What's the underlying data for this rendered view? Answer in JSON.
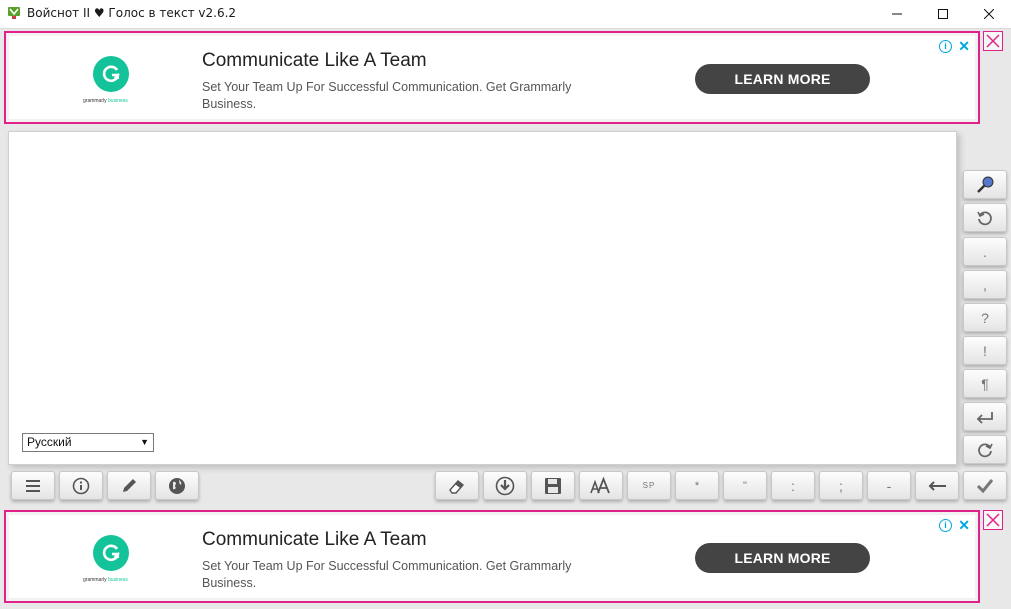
{
  "window": {
    "title": "Войснот II ♥ Голос в текст v2.6.2",
    "minimize_icon": "minimize-icon",
    "maximize_icon": "maximize-icon",
    "close_icon": "close-icon"
  },
  "ad_top": {
    "brand": "grammarly",
    "brand_sub": "business",
    "headline": "Communicate Like A Team",
    "body": "Set Your Team Up For Successful Communication. Get Grammarly Business.",
    "cta": "LEARN MORE",
    "info": "i",
    "dismiss": "✕"
  },
  "ad_bottom": {
    "brand": "grammarly",
    "brand_sub": "business",
    "headline": "Communicate Like A Team",
    "body": "Set Your Team Up For Successful Communication. Get Grammarly Business.",
    "cta": "LEARN MORE",
    "info": "i",
    "dismiss": "✕"
  },
  "editor": {
    "language": "Русский"
  },
  "side_buttons": {
    "period": ".",
    "comma": ",",
    "question": "?",
    "exclamation": "!",
    "paragraph": "¶"
  },
  "bottom_buttons": {
    "space": "SP",
    "asterisk": "*",
    "quote": "\"",
    "colon": ":",
    "semicolon": ";",
    "dash": "-"
  },
  "colors": {
    "ad_border": "#e0218a",
    "grammarly_green": "#15c39a",
    "cta_bg": "#444444",
    "ad_info": "#00a8e0"
  }
}
